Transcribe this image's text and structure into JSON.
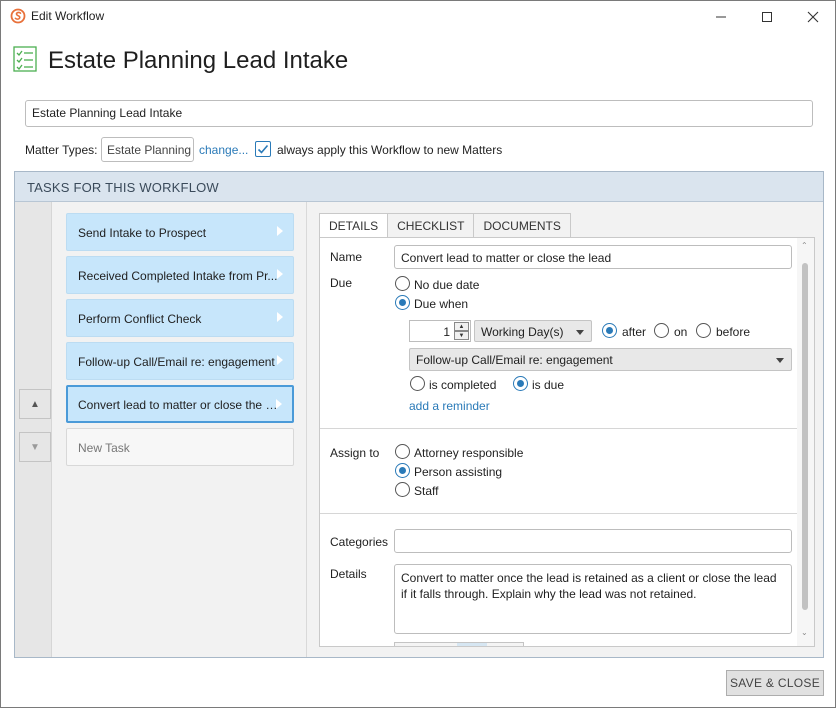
{
  "window": {
    "title": "Edit Workflow",
    "icons": [
      "app-logo-icon",
      "minimize-icon",
      "maximize-icon",
      "close-icon"
    ]
  },
  "header": {
    "title": "Estate Planning Lead Intake",
    "icon": "checklist-icon"
  },
  "workflow": {
    "name_value": "Estate Planning Lead Intake",
    "matter_types_label": "Matter Types:",
    "matter_types_value": "Estate Planning",
    "change_link": "change...",
    "always_apply_checked": true,
    "always_apply_label": "always apply this Workflow to new Matters"
  },
  "tasks_panel": {
    "header": "TASKS FOR THIS WORKFLOW",
    "tasks": [
      {
        "label": "Send Intake to Prospect",
        "selected": false
      },
      {
        "label": "Received Completed Intake from Pr...",
        "selected": false
      },
      {
        "label": "Perform Conflict Check",
        "selected": false
      },
      {
        "label": "Follow-up Call/Email re: engagement",
        "selected": false
      },
      {
        "label": "Convert lead to matter or close the l...",
        "selected": true
      }
    ],
    "new_task_label": "New Task",
    "move_up_icon": "triangle-up-icon",
    "move_down_icon": "triangle-down-icon"
  },
  "detail": {
    "tabs": [
      {
        "label": "DETAILS",
        "active": true
      },
      {
        "label": "CHECKLIST",
        "active": false
      },
      {
        "label": "DOCUMENTS",
        "active": false
      }
    ],
    "name_label": "Name",
    "name_value": "Convert lead to matter or close the lead",
    "due_label": "Due",
    "due_options": [
      "No due date",
      "Due when"
    ],
    "due_selected": "Due when",
    "offset_value": "1",
    "unit_value": "Working Day(s)",
    "relation_options": [
      "after",
      "on",
      "before"
    ],
    "relation_selected": "after",
    "reference_task": "Follow-up Call/Email re: engagement",
    "state_options": [
      "is completed",
      "is due"
    ],
    "state_selected": "is due",
    "add_reminder": "add a reminder",
    "assign_label": "Assign to",
    "assign_options": [
      "Attorney responsible",
      "Person assisting",
      "Staff"
    ],
    "assign_selected": "Person assisting",
    "categories_label": "Categories",
    "categories_value": "",
    "details_label": "Details",
    "details_value": "Convert to matter once the lead is retained as a client or close the lead if it falls through. Explain why the lead was not retained."
  },
  "footer": {
    "save_label": "SAVE & CLOSE"
  },
  "colors": {
    "accent": "#2a7ab8",
    "task_bg": "#c7e6fb",
    "selected_border": "#4a9ad8",
    "panel_header_bg": "#dae4ee",
    "logo_orange": "#e8703a",
    "checklist_green": "#4caf50"
  }
}
